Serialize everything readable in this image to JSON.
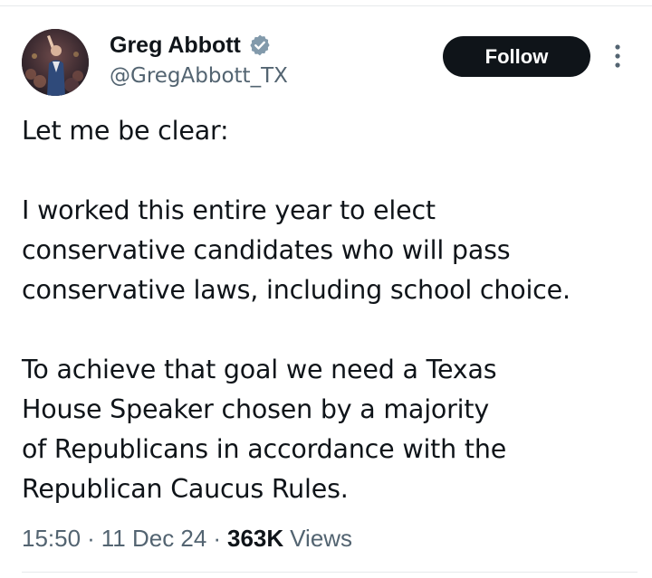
{
  "author": {
    "display_name": "Greg Abbott",
    "handle": "@GregAbbott_TX",
    "verified": true
  },
  "actions": {
    "follow_label": "Follow"
  },
  "tweet": {
    "paragraphs": [
      [
        "Let me be clear:"
      ],
      [
        "I worked this entire year to elect",
        "conservative candidates who will pass",
        "conservative laws, including school choice."
      ],
      [
        "To achieve that goal we need a Texas",
        "House Speaker chosen by a majority",
        "of Republicans in accordance with the",
        "Republican Caucus Rules."
      ]
    ]
  },
  "meta": {
    "time": "15:50",
    "separator": "·",
    "date": "11 Dec 24",
    "views_count": "363K",
    "views_label": "Views"
  },
  "colors": {
    "text_primary": "#0f1419",
    "text_secondary": "#536471",
    "verified_badge": "#829aab",
    "follow_bg": "#0f1419",
    "divider": "#e6e9eb"
  },
  "icons": {
    "verified": "verified-badge-icon",
    "more": "more-vertical-icon"
  }
}
